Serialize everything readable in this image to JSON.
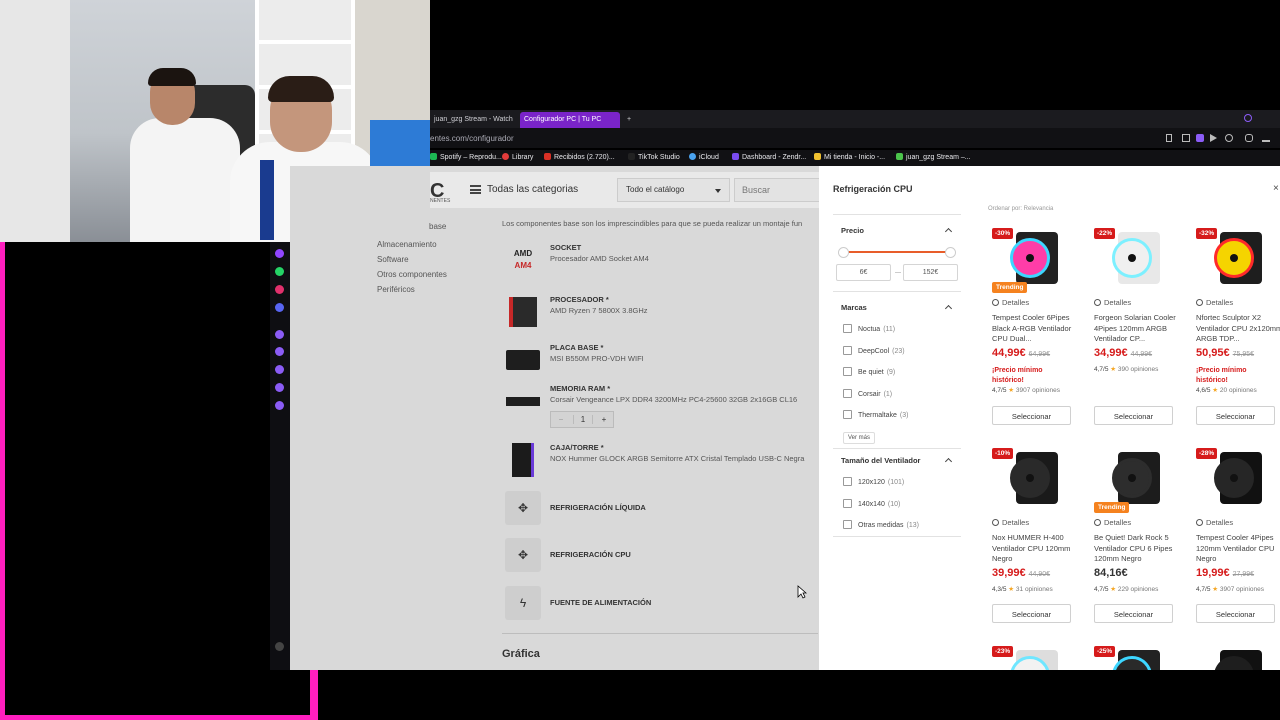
{
  "browser": {
    "tabs": [
      {
        "label": "juan_gzg Stream - Watch",
        "active": false
      },
      {
        "label": "Configurador PC | Tu PC",
        "active": true
      },
      {
        "label": "+",
        "active": false
      }
    ],
    "url": "entes.com/configurador",
    "bookmarks": [
      {
        "label": "Spotify – Reprodu...",
        "color": "#1db954"
      },
      {
        "label": "Library",
        "color": "#e23b3b"
      },
      {
        "label": "Recibidos (2.720)...",
        "color": "#d93025"
      },
      {
        "label": "TikTok Studio",
        "color": "#222222"
      },
      {
        "label": "iCloud",
        "color": "#4aa3f0"
      },
      {
        "label": "Dashboard - Zendr...",
        "color": "#7a4cf0"
      },
      {
        "label": "Mi tienda - Inicio -...",
        "color": "#f2c230"
      },
      {
        "label": "juan_gzg Stream –...",
        "color": "#4bc44b"
      }
    ]
  },
  "header": {
    "logo": "C",
    "logo_sub": "NENTES",
    "categories": "Todas las categorias",
    "catalog": "Todo el catálogo",
    "search_placeholder": "Buscar"
  },
  "leftnav": [
    "base",
    "Almacenamiento",
    "Software",
    "Otros componentes",
    "Periféricos"
  ],
  "intro": "Los componentes base son los imprescindibles para que se pueda realizar un montaje fun",
  "components": [
    {
      "title": "SOCKET",
      "subtitle": "Procesador AMD Socket AM4",
      "icon": "amd-am4-icon"
    },
    {
      "title": "PROCESADOR *",
      "subtitle": "AMD Ryzen 7 5800X 3.8GHz",
      "icon": "cpu-box-icon"
    },
    {
      "title": "PLACA BASE *",
      "subtitle": "MSI B550M PRO-VDH WIFI",
      "icon": "motherboard-icon"
    },
    {
      "title": "MEMORIA RAM *",
      "subtitle": "Corsair Vengeance LPX DDR4 3200MHz PC4-25600 32GB 2x16GB CL16",
      "icon": "ram-icon",
      "quantity": "1"
    },
    {
      "title": "CAJA/TORRE *",
      "subtitle": "NOX Hummer GLOCK ARGB Semitorre ATX Cristal Templado USB-C Negra",
      "icon": "case-icon"
    },
    {
      "title": "REFRIGERACIÓN LÍQUIDA",
      "subtitle": "",
      "icon": "fan-icon"
    },
    {
      "title": "REFRIGERACIÓN CPU",
      "subtitle": "",
      "icon": "fan-icon"
    },
    {
      "title": "FUENTE DE ALIMENTACIÓN",
      "subtitle": "",
      "icon": "bolt-icon"
    }
  ],
  "qty_minus": "−",
  "qty_plus": "+",
  "section_next": "Gráfica",
  "panel": {
    "title": "Refrigeración CPU",
    "close": "×",
    "sort_label": "Ordenar por: Relevancia",
    "price": {
      "label": "Precio",
      "min": "6€",
      "max": "152€"
    },
    "brands": {
      "label": "Marcas",
      "items": [
        {
          "name": "Noctua",
          "count": "(11)"
        },
        {
          "name": "DeepCool",
          "count": "(23)"
        },
        {
          "name": "Be quiet",
          "count": "(9)"
        },
        {
          "name": "Corsair",
          "count": "(1)"
        },
        {
          "name": "Thermaltake",
          "count": "(3)"
        }
      ],
      "more": "Ver más"
    },
    "fan_size": {
      "label": "Tamaño del Ventilador",
      "items": [
        {
          "name": "120x120",
          "count": "(101)"
        },
        {
          "name": "140x140",
          "count": "(10)"
        },
        {
          "name": "Otras medidas",
          "count": "(13)"
        }
      ]
    },
    "details_label": "Detalles",
    "select_label": "Seleccionar",
    "historic": "¡Precio mínimo histórico!",
    "trending": "Trending",
    "products": [
      {
        "discount": "-30%",
        "trending": true,
        "name": "Tempest Cooler 6Pipes Black A-RGB Ventilador CPU Dual...",
        "price": "44,99€",
        "old": "64,99€",
        "historic": true,
        "rating": "4,7/5",
        "opinions": "3907 opiniones",
        "red": true
      },
      {
        "discount": "-22%",
        "trending": false,
        "name": "Forgeon Solarian Cooler 4Pipes 120mm ARGB Ventilador CP...",
        "price": "34,99€",
        "old": "44,99€",
        "historic": false,
        "rating": "4,7/5",
        "opinions": "390 opiniones",
        "red": true
      },
      {
        "discount": "-32%",
        "trending": false,
        "name": "Nfortec Sculptor X2 Ventilador CPU 2x120mm ARGB TDP...",
        "price": "50,95€",
        "old": "75,95€",
        "historic": true,
        "rating": "4,6/5",
        "opinions": "20 opiniones",
        "red": true
      },
      {
        "discount": "-10%",
        "trending": false,
        "name": "Nox HUMMER H-400 Ventilador CPU 120mm Negro",
        "price": "39,99€",
        "old": "44,90€",
        "historic": false,
        "rating": "4,3/5",
        "opinions": "31 opiniones",
        "red": true
      },
      {
        "discount": "",
        "trending": true,
        "name": "Be Quiet! Dark Rock 5 Ventilador CPU 6 Pipes 120mm Negro",
        "price": "84,16€",
        "old": "",
        "historic": false,
        "rating": "4,7/5",
        "opinions": "229 opiniones",
        "red": false
      },
      {
        "discount": "-28%",
        "trending": false,
        "name": "Tempest Cooler 4Pipes 120mm Ventilador CPU Negro",
        "price": "19,99€",
        "old": "27,99€",
        "historic": false,
        "rating": "4,7/5",
        "opinions": "3907 opiniones",
        "red": true
      },
      {
        "discount": "-23%",
        "trending": false,
        "name": "",
        "price": "",
        "old": "",
        "historic": false,
        "rating": "",
        "opinions": "",
        "red": true
      },
      {
        "discount": "-25%",
        "trending": false,
        "name": "",
        "price": "",
        "old": "",
        "historic": false,
        "rating": "",
        "opinions": "",
        "red": true
      },
      {
        "discount": "",
        "trending": false,
        "name": "",
        "price": "",
        "old": "",
        "historic": false,
        "rating": "",
        "opinions": "",
        "red": false
      }
    ]
  }
}
